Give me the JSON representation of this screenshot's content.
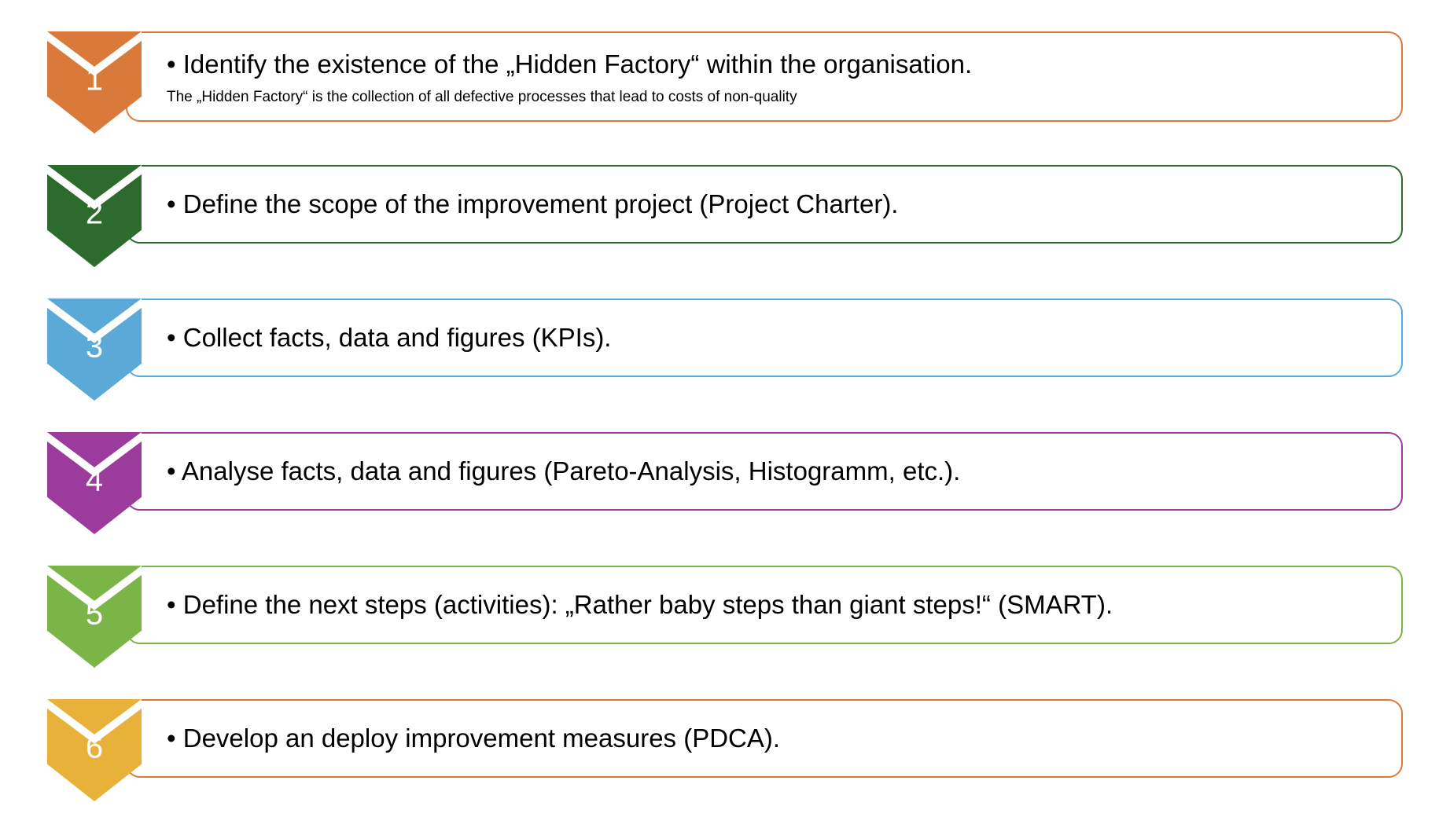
{
  "steps": [
    {
      "number": "1",
      "color": "#d97a3a",
      "text": "Identify the existence of the „Hidden Factory“  within the organisation.",
      "subtext": "The „Hidden Factory“ is the collection of all defective processes that lead to costs of non-quality"
    },
    {
      "number": "2",
      "color": "#2d6a2d",
      "text": "Define the scope of the improvement project (Project Charter).",
      "subtext": ""
    },
    {
      "number": "3",
      "color": "#5aa9d6",
      "text": "Collect facts, data and figures (KPIs).",
      "subtext": ""
    },
    {
      "number": "4",
      "color": "#9b3b9b",
      "text": "Analyse facts, data and figures (Pareto-Analysis, Histogramm, etc.).",
      "subtext": ""
    },
    {
      "number": "5",
      "color": "#7bb547",
      "text": "Define the next steps (activities): „Rather baby steps than giant steps!“ (SMART).",
      "subtext": ""
    },
    {
      "number": "6",
      "color": "#e8b23a",
      "text": "Develop an deploy improvement measures (PDCA).",
      "subtext": ""
    }
  ]
}
